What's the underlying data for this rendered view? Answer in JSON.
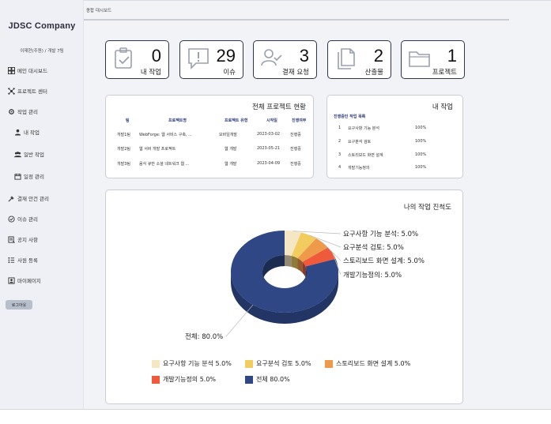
{
  "brand": "JDSC Company",
  "user_info": "이재현(주원) / 개발 7팀",
  "breadcrumb": "종합 대시보드",
  "nav": [
    {
      "label": "메인 대시보드",
      "icon": "dashboard-icon"
    },
    {
      "label": "프로젝트 센터",
      "icon": "project-network-icon"
    },
    {
      "label": "작업 관리",
      "icon": "task-gear-icon"
    },
    {
      "label": "내 작업",
      "icon": "person-icon"
    },
    {
      "label": "일반 작업",
      "icon": "group-icon"
    },
    {
      "label": "일정 관리",
      "icon": "calendar-icon"
    },
    {
      "label": "결재 안건 관리",
      "icon": "approval-icon"
    },
    {
      "label": "이슈 관리",
      "icon": "check-circle-icon"
    },
    {
      "label": "공지 사항",
      "icon": "notice-icon"
    },
    {
      "label": "사원 등록",
      "icon": "employee-list-icon"
    },
    {
      "label": "마이페이지",
      "icon": "mypage-icon"
    }
  ],
  "logout_label": "로그아웃",
  "stats": [
    {
      "value": "0",
      "label": "내 작업",
      "icon": "clipboard-check-icon"
    },
    {
      "value": "29",
      "label": "이슈",
      "icon": "alert-message-icon"
    },
    {
      "value": "3",
      "label": "결재 요청",
      "icon": "user-check-icon"
    },
    {
      "value": "2",
      "label": "산출물",
      "icon": "documents-icon"
    },
    {
      "value": "1",
      "label": "프로젝트",
      "icon": "folder-icon"
    }
  ],
  "projects": {
    "title": "전체 프로젝트 현황",
    "headers": [
      "팀",
      "프로젝트명",
      "프로젝트 유형",
      "시작일",
      "진행여부"
    ],
    "rows": [
      [
        "개발1팀",
        "WebForge: 웹 서비스 구축, ...",
        "모바일개발",
        "2023-03-02",
        "진행중"
      ],
      [
        "개발2팀",
        "웹 서버 개발 프로젝트",
        "웹 개발",
        "2023-05-21",
        "진행중"
      ],
      [
        "개발3팀",
        "음식 큐반 소셜 네트워크 웹 ...",
        "웹 개발",
        "2023-04-09",
        "진행중"
      ]
    ]
  },
  "my_tasks": {
    "title": "내 작업",
    "subtitle": "진행중인 작업 목록",
    "rows": [
      [
        "1",
        "요구사항 기능 분석",
        "100%"
      ],
      [
        "2",
        "요구분석 검토",
        "100%"
      ],
      [
        "3",
        "스토리보드 화면 설계",
        "100%"
      ],
      [
        "4",
        "개발기능정의",
        "100%"
      ]
    ]
  },
  "progress": {
    "title": "나의 작업 진척도"
  },
  "chart_data": {
    "type": "pie",
    "title": "나의 작업 진척도",
    "donut": true,
    "slices": [
      {
        "label": "요구사항 기능 분석",
        "value": 5.0,
        "color": "#f5e6c4",
        "text": "요구사항 기능 분석: 5.0%",
        "legend": "요구사항 기능 분석 5.0%"
      },
      {
        "label": "요구분석 검토",
        "value": 5.0,
        "color": "#f2cc5e",
        "text": "요구분석 검토: 5.0%",
        "legend": "요구분석 검토 5.0%"
      },
      {
        "label": "스토리보드 화면 설계",
        "value": 5.0,
        "color": "#ee9a4a",
        "text": "스토리보드 화면 설계: 5.0%",
        "legend": "스토리보드 화면 설계 5.0%"
      },
      {
        "label": "개발기능정의",
        "value": 5.0,
        "color": "#f05a3c",
        "text": "개발기능정의: 5.0%",
        "legend": "개발기능정의 5.0%"
      },
      {
        "label": "전체",
        "value": 80.0,
        "color": "#2f4785",
        "text": "전체: 80.0%",
        "legend": "전체 80.0%"
      }
    ]
  }
}
